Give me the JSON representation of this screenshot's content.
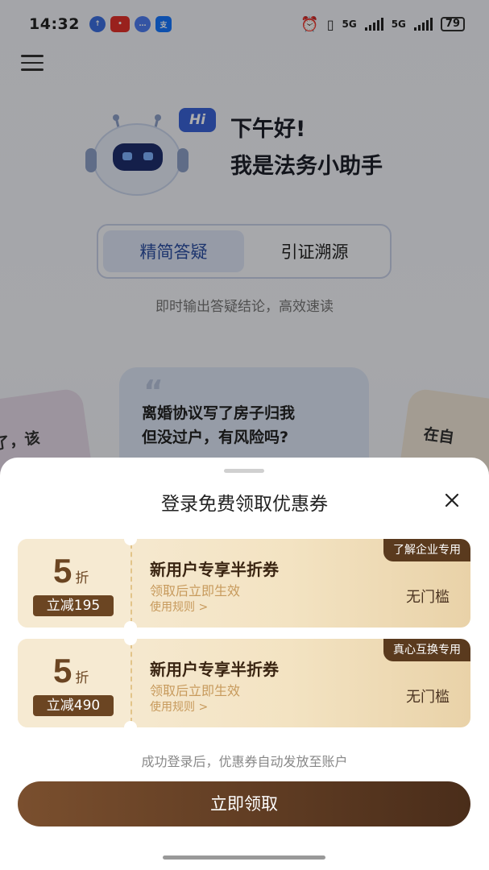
{
  "status_bar": {
    "time": "14:32",
    "network_1": "5G",
    "network_2": "5G",
    "battery": "79"
  },
  "background": {
    "hi_label": "Hi",
    "greeting_line1": "下午好!",
    "greeting_line2": "我是法务小助手",
    "tabs": [
      {
        "label": "精简答疑",
        "active": true
      },
      {
        "label": "引证溯源",
        "active": false
      }
    ],
    "mode_description": "即时输出答疑结论，高效速读",
    "question_card": {
      "quote_mark": "“",
      "line1": "离婚协议写了房子归我",
      "line2": "但没过户，有风险吗?"
    },
    "side_card_left_text": "了，该",
    "side_card_right_text": "在自"
  },
  "sheet": {
    "title": "登录免费领取优惠券",
    "coupons": [
      {
        "discount": "5",
        "discount_unit": "折",
        "reduce": "立减195",
        "title": "新用户专享半折券",
        "subtitle": "领取后立即生效",
        "rule": "使用规则 >",
        "threshold": "无门槛",
        "tag": "了解企业专用"
      },
      {
        "discount": "5",
        "discount_unit": "折",
        "reduce": "立减490",
        "title": "新用户专享半折券",
        "subtitle": "领取后立即生效",
        "rule": "使用规则 >",
        "threshold": "无门槛",
        "tag": "真心互换专用"
      }
    ],
    "footnote": "成功登录后，优惠券自动发放至账户",
    "claim_button": "立即领取"
  },
  "colors": {
    "accent_brown": "#6b4522",
    "tab_active": "#2c4ea3",
    "hi_bubble": "#3a63d8"
  }
}
